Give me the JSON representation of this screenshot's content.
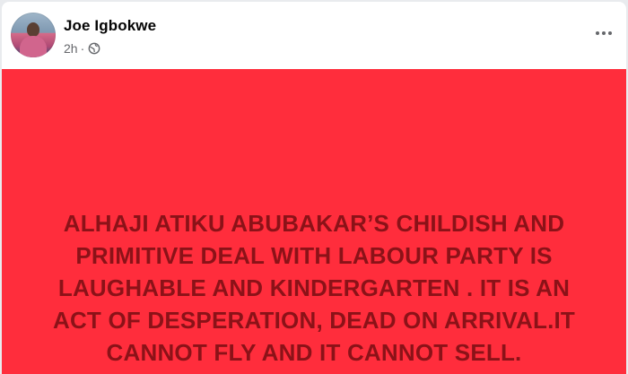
{
  "post": {
    "author_name": "Joe Igbokwe",
    "timestamp": "2h",
    "separator": "·",
    "privacy_icon": "globe-icon",
    "menu_icon": "more-options-icon",
    "background_color": "#ff2d3c",
    "text_color": "#8b1218",
    "text_lines": [
      "ALHAJI ATIKU ABUBAKAR’S CHILDISH AND",
      "PRIMITIVE DEAL WITH LABOUR PARTY IS",
      "LAUGHABLE AND KINDERGARTEN . IT IS AN",
      "ACT OF DESPERATION, DEAD ON ARRIVAL.IT",
      "CANNOT FLY AND IT CANNOT SELL."
    ]
  }
}
